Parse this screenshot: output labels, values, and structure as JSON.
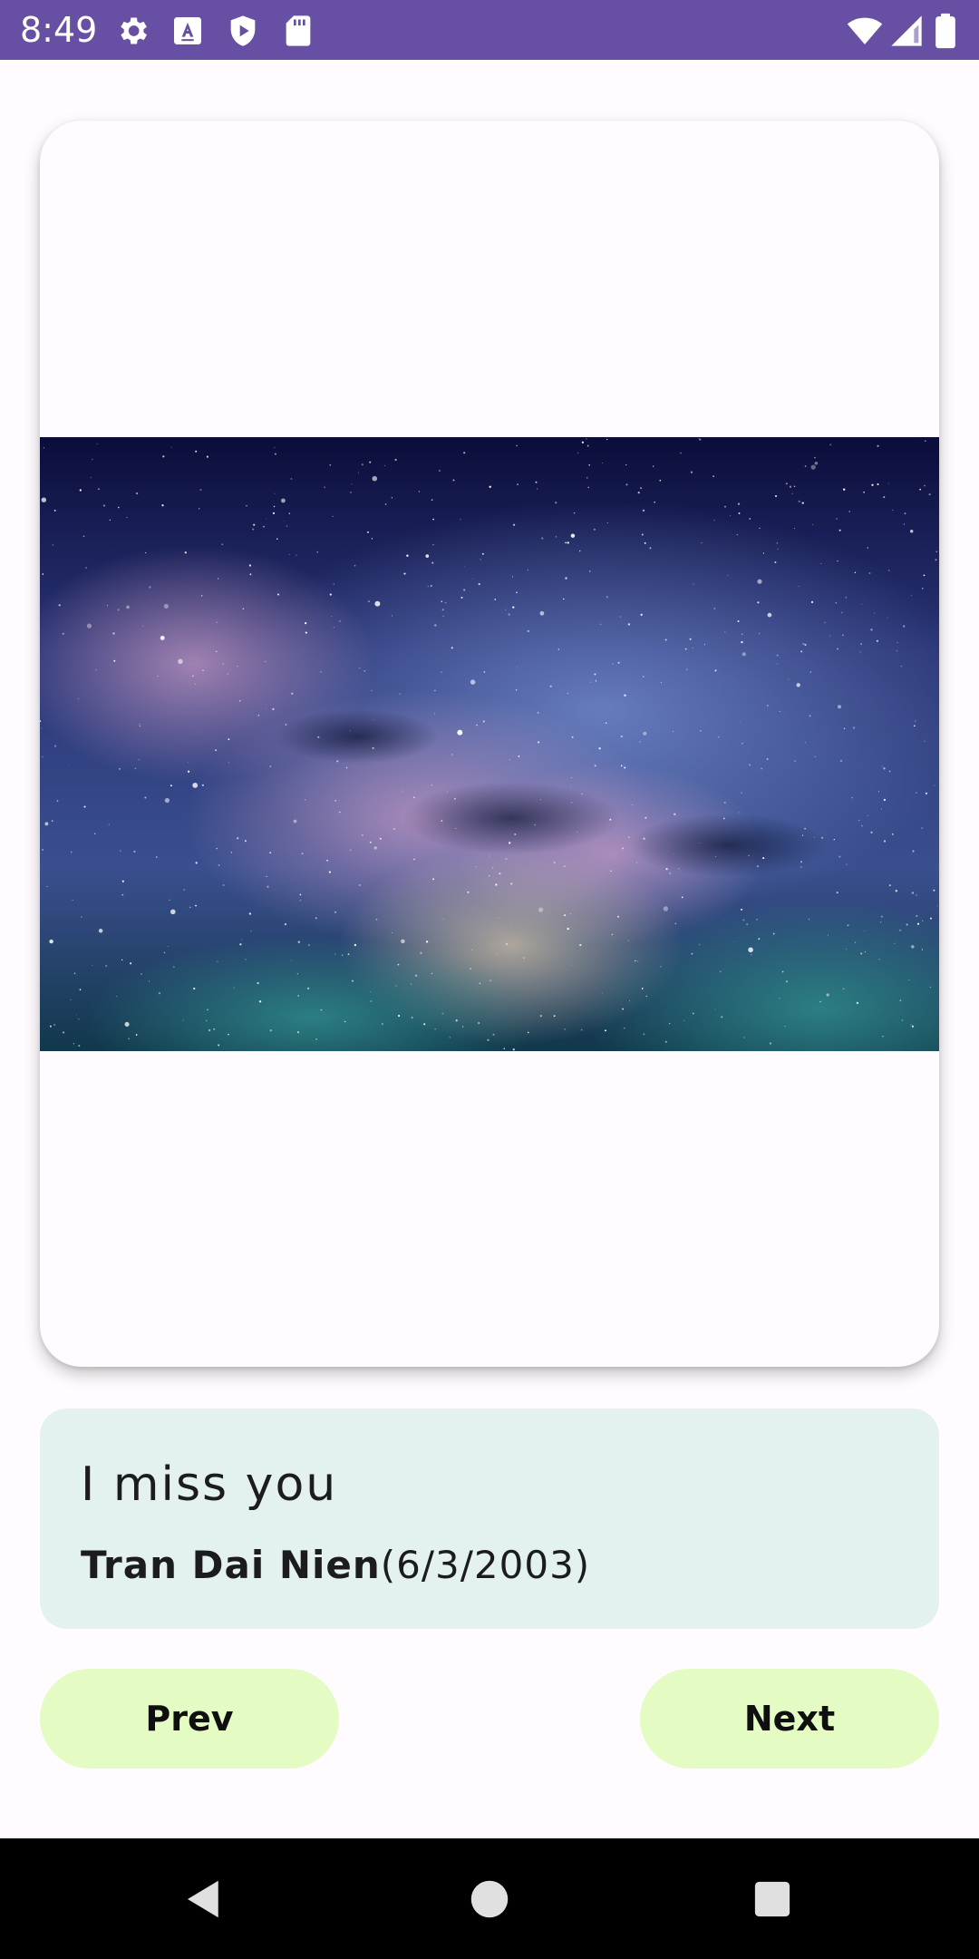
{
  "status_bar": {
    "time": "8:49",
    "background": "#6750A4",
    "icons": [
      "settings-icon",
      "a11y-a-icon",
      "play-protect-icon",
      "sd-card-icon",
      "wifi-icon",
      "cell-signal-icon",
      "battery-icon"
    ]
  },
  "card": {
    "image": {
      "subject": "starry-night-sky-milky-way"
    }
  },
  "message": {
    "text": "I miss you",
    "author_name": "Tran Dai Nien",
    "author_date": "(6/3/2003)",
    "background": "#E3F1F1"
  },
  "buttons": {
    "prev_label": "Prev",
    "next_label": "Next",
    "background": "#E4FCC4"
  },
  "nav_bar": {
    "back": "back-icon",
    "home": "home-icon",
    "recents": "recents-icon"
  }
}
